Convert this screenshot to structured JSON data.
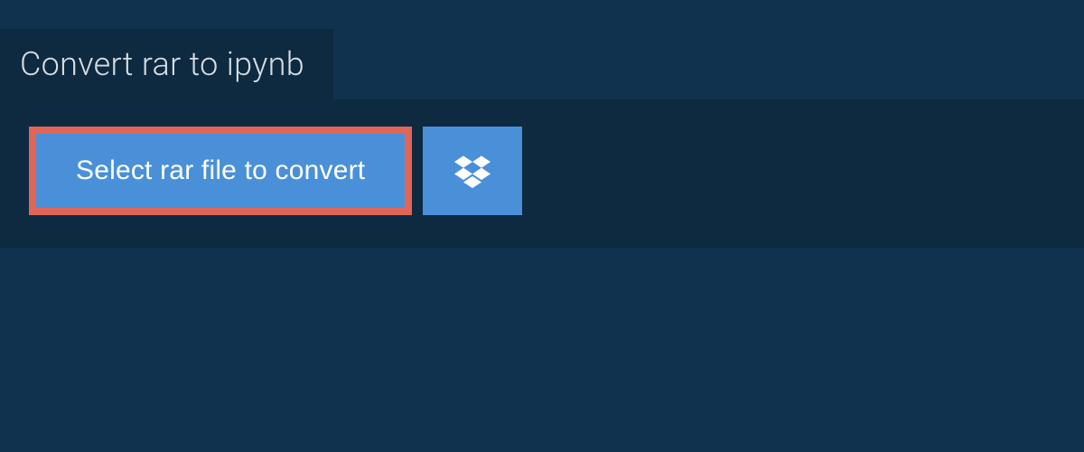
{
  "tab": {
    "title": "Convert rar to ipynb"
  },
  "actions": {
    "select_file_label": "Select rar file to convert"
  },
  "colors": {
    "background": "#11324f",
    "panel": "#0e2a40",
    "button": "#4a90d9",
    "highlight_border": "#e06659",
    "text_light": "#d6dde3",
    "text_white": "#ffffff"
  }
}
